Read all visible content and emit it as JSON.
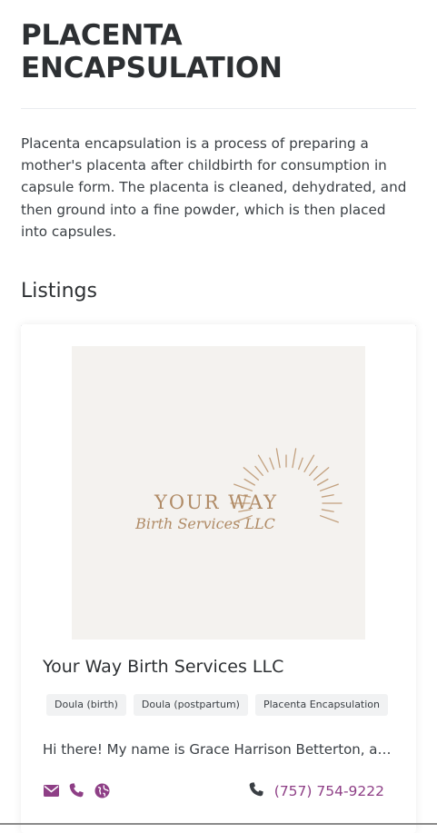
{
  "page": {
    "title_line1": "PLACENTA",
    "title_line2": "ENCAPSULATION",
    "description": "Placenta encapsulation is a process of preparing a mother's placenta after childbirth for consumption in capsule form. The placenta is cleaned, dehydrated, and then ground into a fine powder, which is then placed into capsules."
  },
  "listings": {
    "heading": "Listings",
    "items": [
      {
        "logo": {
          "line1": "YOUR WAY",
          "line2": "Birth Services LLC"
        },
        "name": "Your Way Birth Services LLC",
        "tags": [
          "Doula (birth)",
          "Doula (postpartum)",
          "Placenta Encapsulation"
        ],
        "excerpt": "Hi there! My name is Grace Harrison Betterton, and I am a birth and postpartum doula...",
        "contact_icons": [
          "envelope-icon",
          "phone-icon",
          "globe-icon"
        ],
        "phone": "(757) 754-9222"
      }
    ]
  },
  "colors": {
    "accent": "#8e3f86",
    "text": "#2d3033",
    "logo_gold": "#b08b66",
    "logo_bg": "#f4f2ef"
  }
}
